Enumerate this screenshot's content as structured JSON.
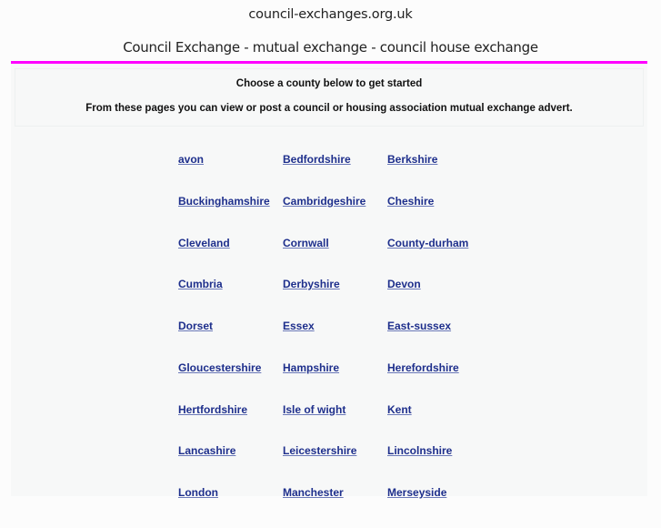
{
  "header": {
    "site_name": "council-exchanges.org.uk",
    "tagline": "Council Exchange - mutual exchange - council house exchange"
  },
  "intro": {
    "heading": "Choose a county below to get started",
    "text": "From these pages you can view or post a council or housing association mutual exchange advert."
  },
  "colors": {
    "accent_rule": "#ff00ff",
    "link": "#1e2f8c",
    "background": "#fcfcfc",
    "content_background": "#f7f8f8"
  },
  "counties": [
    "avon",
    "Bedfordshire",
    "Berkshire",
    "Buckinghamshire",
    "Cambridgeshire",
    "Cheshire",
    "Cleveland",
    "Cornwall",
    "County-durham",
    "Cumbria",
    "Derbyshire",
    "Devon",
    "Dorset",
    "Essex",
    "East-sussex",
    "Gloucestershire",
    "Hampshire",
    "Herefordshire",
    "Hertfordshire",
    "Isle of wight",
    "Kent",
    "Lancashire",
    "Leicestershire",
    "Lincolnshire",
    "London",
    "Manchester",
    "Merseyside"
  ]
}
